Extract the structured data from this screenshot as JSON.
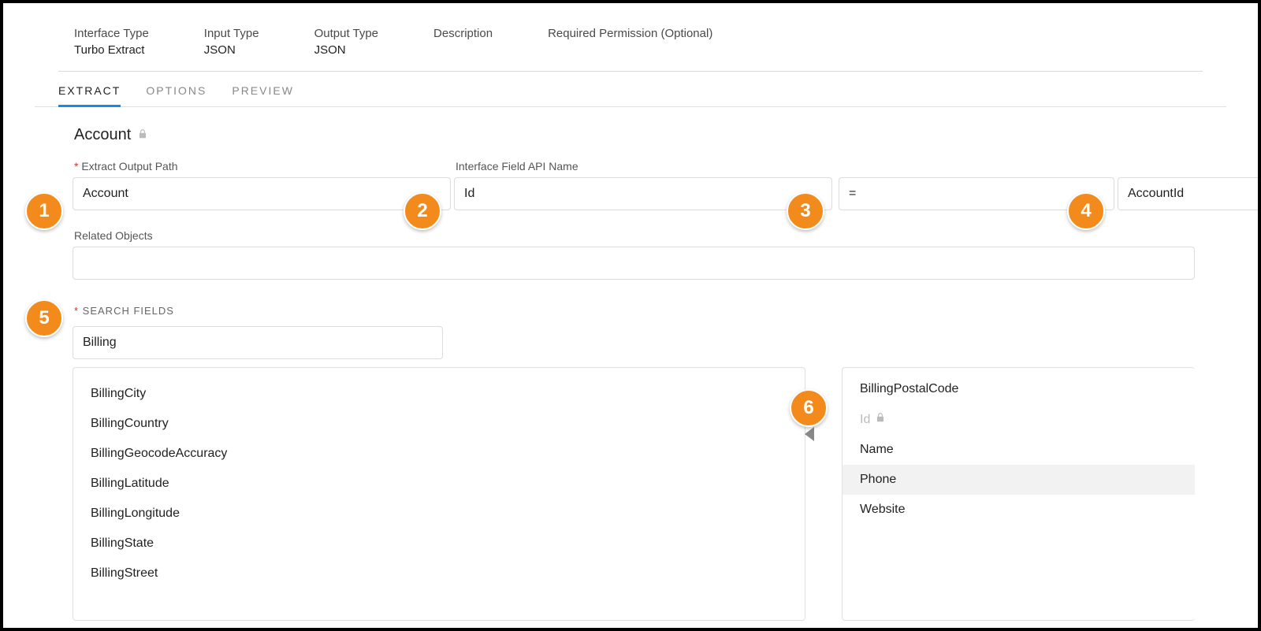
{
  "header": {
    "items": [
      {
        "label": "Interface Type",
        "value": "Turbo Extract"
      },
      {
        "label": "Input Type",
        "value": "JSON"
      },
      {
        "label": "Output Type",
        "value": "JSON"
      },
      {
        "label": "Description",
        "value": ""
      },
      {
        "label": "Required Permission (Optional)",
        "value": ""
      }
    ]
  },
  "tabs": [
    {
      "label": "EXTRACT",
      "active": true
    },
    {
      "label": "OPTIONS",
      "active": false
    },
    {
      "label": "PREVIEW",
      "active": false
    }
  ],
  "section_title": "Account",
  "form": {
    "extract_output_path": {
      "label": "Extract Output Path",
      "value": "Account"
    },
    "interface_field_api_name": {
      "label": "Interface Field API Name",
      "value": "Id"
    },
    "operator": {
      "value": "="
    },
    "compare_value": {
      "value": "AccountId"
    },
    "related_objects": {
      "label": "Related Objects",
      "value": ""
    },
    "search_fields": {
      "label": "SEARCH FIELDS",
      "value": "Billing"
    }
  },
  "available_fields": [
    "BillingCity",
    "BillingCountry",
    "BillingGeocodeAccuracy",
    "BillingLatitude",
    "BillingLongitude",
    "BillingState",
    "BillingStreet"
  ],
  "selected_fields": [
    {
      "label": "BillingPostalCode",
      "locked": false,
      "highlight": false
    },
    {
      "label": "Id",
      "locked": true,
      "highlight": false
    },
    {
      "label": "Name",
      "locked": false,
      "highlight": false
    },
    {
      "label": "Phone",
      "locked": false,
      "highlight": true
    },
    {
      "label": "Website",
      "locked": false,
      "highlight": false
    }
  ],
  "callouts": [
    "1",
    "2",
    "3",
    "4",
    "5",
    "6"
  ]
}
